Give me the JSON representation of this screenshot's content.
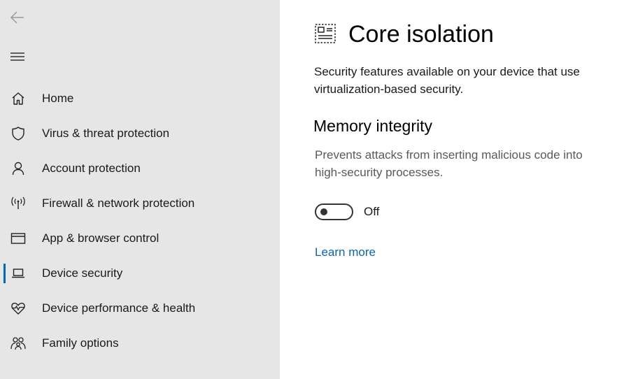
{
  "sidebar": {
    "back_icon": "back-arrow-icon",
    "menu_icon": "hamburger-icon",
    "items": [
      {
        "label": "Home",
        "icon": "home-icon",
        "active": false
      },
      {
        "label": "Virus & threat protection",
        "icon": "shield-icon",
        "active": false
      },
      {
        "label": "Account protection",
        "icon": "person-icon",
        "active": false
      },
      {
        "label": "Firewall & network protection",
        "icon": "antenna-icon",
        "active": false
      },
      {
        "label": "App & browser control",
        "icon": "browser-window-icon",
        "active": false
      },
      {
        "label": "Device security",
        "icon": "laptop-icon",
        "active": true
      },
      {
        "label": "Device performance & health",
        "icon": "heart-pulse-icon",
        "active": false
      },
      {
        "label": "Family options",
        "icon": "family-icon",
        "active": false
      }
    ]
  },
  "main": {
    "title_icon": "core-isolation-chip-icon",
    "title": "Core isolation",
    "description": "Security features available on your device that use virtualization-based security.",
    "memory_integrity": {
      "title": "Memory integrity",
      "description": "Prevents attacks from inserting malicious code into high-security processes.",
      "toggle_state": "Off",
      "toggle_on": false
    },
    "learn_more": "Learn more"
  },
  "colors": {
    "sidebar_bg": "#e6e6e6",
    "accent": "#0067c0",
    "link": "#0b64b4"
  }
}
